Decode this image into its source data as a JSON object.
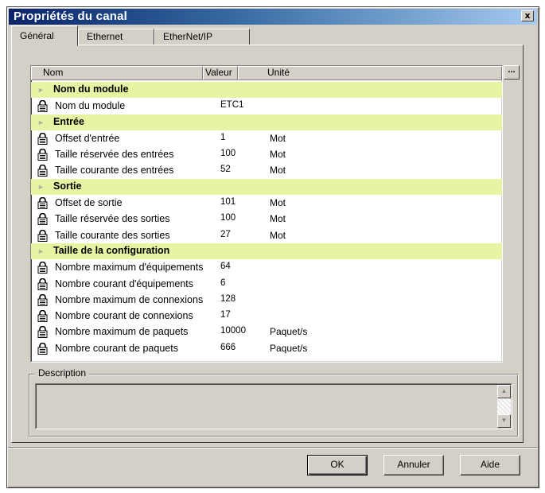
{
  "window": {
    "title": "Propriétés du canal",
    "close_label": "x"
  },
  "tabs": [
    {
      "label": "Général",
      "active": true
    },
    {
      "label": "Ethernet",
      "active": false
    },
    {
      "label": "EtherNet/IP",
      "active": false
    }
  ],
  "list": {
    "columns": {
      "name": "Nom",
      "value": "Valeur",
      "unit": "Unité"
    },
    "ellipsis_label": "...",
    "section_color": "#e8f4a4",
    "rows": [
      {
        "section": "Nom du module"
      },
      {
        "name": "Nom du module",
        "value": "ETC1",
        "unit": ""
      },
      {
        "section": "Entrée"
      },
      {
        "name": "Offset d'entrée",
        "value": "1",
        "unit": "Mot"
      },
      {
        "name": "Taille réservée des entrées",
        "value": "100",
        "unit": "Mot"
      },
      {
        "name": "Taille courante des entrées",
        "value": "52",
        "unit": "Mot"
      },
      {
        "section": "Sortie"
      },
      {
        "name": "Offset de sortie",
        "value": "101",
        "unit": "Mot"
      },
      {
        "name": "Taille réservée des sorties",
        "value": "100",
        "unit": "Mot"
      },
      {
        "name": "Taille courante des sorties",
        "value": "27",
        "unit": "Mot"
      },
      {
        "section": "Taille de la configuration"
      },
      {
        "name": "Nombre maximum d'équipements",
        "value": "64",
        "unit": ""
      },
      {
        "name": "Nombre courant d'équipements",
        "value": "6",
        "unit": ""
      },
      {
        "name": "Nombre maximum de connexions",
        "value": "128",
        "unit": ""
      },
      {
        "name": "Nombre courant de connexions",
        "value": "17",
        "unit": ""
      },
      {
        "name": "Nombre maximum de paquets",
        "value": "10000",
        "unit": "Paquet/s"
      },
      {
        "name": "Nombre courant de paquets",
        "value": "666",
        "unit": "Paquet/s"
      }
    ]
  },
  "description": {
    "legend": "Description",
    "text": ""
  },
  "buttons": {
    "ok": "OK",
    "cancel": "Annuler",
    "help": "Aide"
  }
}
